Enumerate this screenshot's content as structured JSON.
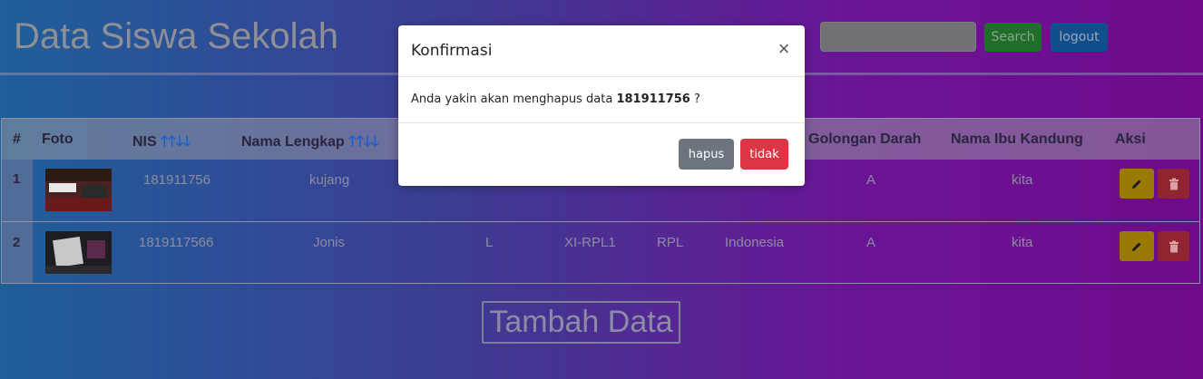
{
  "header": {
    "title": "Data Siswa Sekolah",
    "search_value": "",
    "search_label": "Search",
    "logout_label": "logout"
  },
  "table": {
    "headers": {
      "num": "#",
      "foto": "Foto",
      "nis": "NIS",
      "nama": "Nama Lengkap",
      "golongan": "Golongan Darah",
      "ibu": "Nama Ibu Kandung",
      "aksi": "Aksi"
    },
    "sort_asc_glyph": "🡑🡑",
    "sort_desc_glyph": "🡓🡓",
    "rows": [
      {
        "num": "1",
        "nis": "181911756",
        "nama": "kujang",
        "golongan": "A",
        "ibu": "kita"
      },
      {
        "num": "2",
        "nis": "1819117566",
        "nama": "Jonis",
        "jk": "L",
        "kelas": "XI-RPL1",
        "jurusan": "RPL",
        "negara": "Indonesia",
        "golongan": "A",
        "ibu": "kita"
      }
    ]
  },
  "add_label": "Tambah Data",
  "modal": {
    "title": "Konfirmasi",
    "close": "×",
    "message_prefix": "Anda yakin akan menghapus data",
    "message_id": "181911756",
    "message_suffix": "?",
    "hapus_label": "hapus",
    "tidak_label": "tidak"
  },
  "colors": {
    "modal_bg": "#ffffff",
    "hapus": "#6c757d",
    "tidak": "#dc3545",
    "edit": "#9a7a06",
    "delete": "#902530"
  }
}
